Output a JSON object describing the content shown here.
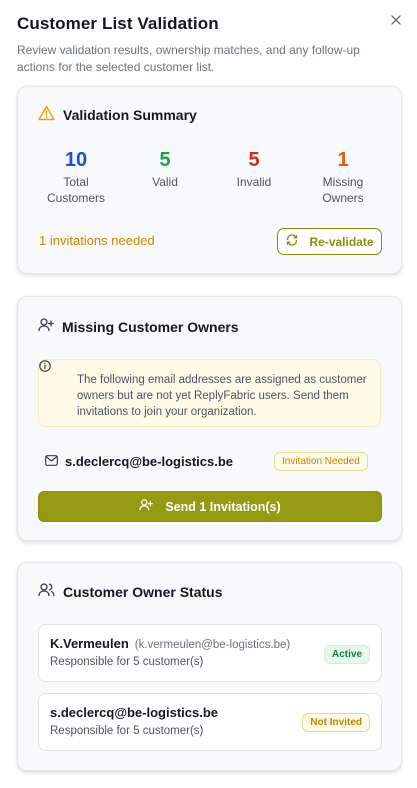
{
  "header": {
    "title": "Customer List Validation",
    "subtitle": "Review validation results, ownership matches, and any follow-up actions for the selected customer list."
  },
  "summary": {
    "title": "Validation Summary",
    "stats": [
      {
        "value": "10",
        "label": "Total Customers",
        "color": "#1d4ed8"
      },
      {
        "value": "5",
        "label": "Valid",
        "color": "#16a34a"
      },
      {
        "value": "5",
        "label": "Invalid",
        "color": "#dc2626"
      },
      {
        "value": "1",
        "label": "Missing Owners",
        "color": "#ea580c"
      }
    ],
    "invitations_needed": "1 invitations needed",
    "revalidate_label": "Re-validate"
  },
  "missing": {
    "title": "Missing Customer Owners",
    "notice": "The following email addresses are assigned as customer owners but are not yet ReplyFabric users. Send them invitations to join your organization.",
    "email": "s.declercq@be-logistics.be",
    "badge": "Invitation Needed",
    "send_label": "Send 1 Invitation(s)"
  },
  "status": {
    "title": "Customer Owner Status",
    "owners": [
      {
        "name": "K.Vermeulen",
        "email": "(k.vermeulen@be-logistics.be)",
        "responsible": "Responsible for 5 customer(s)",
        "status": "Active"
      },
      {
        "name": "s.declercq@be-logistics.be",
        "email": "",
        "responsible": "Responsible for 5 customer(s)",
        "status": "Not Invited"
      }
    ]
  },
  "colors": {
    "accent": "#949a12",
    "warning": "#c48a00"
  }
}
